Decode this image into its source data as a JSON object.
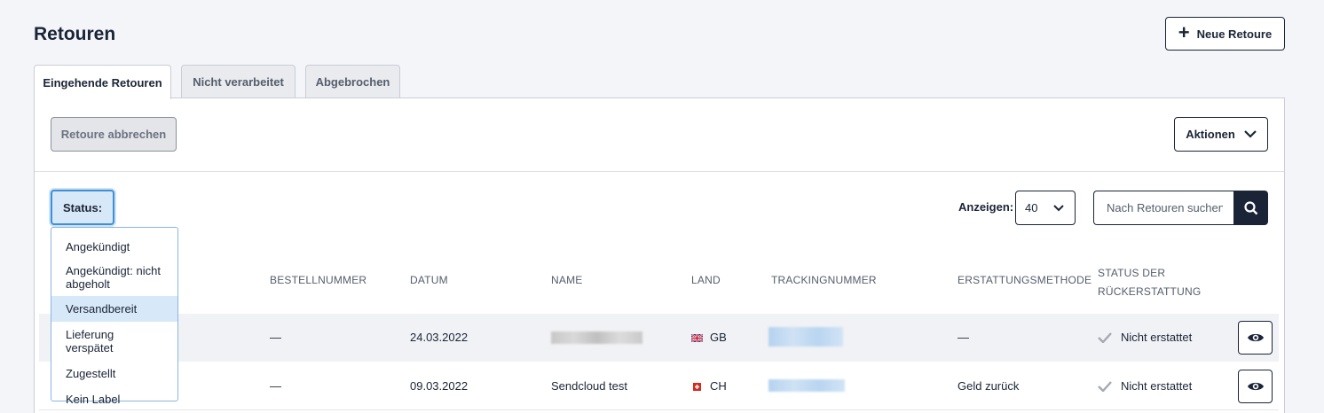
{
  "page": {
    "title": "Retouren",
    "new_return_label": "Neue Retoure"
  },
  "tabs": [
    {
      "label": "Eingehende Retouren",
      "active": true
    },
    {
      "label": "Nicht verarbeitet",
      "active": false
    },
    {
      "label": "Abgebrochen",
      "active": false
    }
  ],
  "toolbar": {
    "cancel_label": "Retoure abbrechen",
    "actions_label": "Aktionen"
  },
  "filters": {
    "status_label": "Status:",
    "show_label": "Anzeigen:",
    "per_page": "40",
    "search_placeholder": "Nach Retouren suchen"
  },
  "status_dropdown": {
    "options": [
      "Angekündigt",
      "Angekündigt: nicht abgeholt",
      "Versandbereit",
      "Lieferung verspätet",
      "Zugestellt",
      "Kein Label"
    ],
    "highlighted": "Versandbereit"
  },
  "table": {
    "columns": {
      "order": "BESTELLNUMMER",
      "date": "DATUM",
      "name": "NAME",
      "country": "LAND",
      "tracking": "TRACKINGNUMMER",
      "refund_method": "ERSTATTUNGSMETHODE",
      "refund_status_1": "STATUS DER",
      "refund_status_2": "RÜCKERSTATTUNG"
    },
    "rows": [
      {
        "order": "—",
        "date": "24.03.2022",
        "name": "",
        "country": "GB",
        "tracking": "",
        "refund_method": "—",
        "refund_status": "Nicht erstattet"
      },
      {
        "order": "—",
        "date": "09.03.2022",
        "name": "Sendcloud test",
        "country": "CH",
        "tracking": "",
        "refund_method": "Geld zurück",
        "refund_status": "Nicht erstattet"
      }
    ]
  },
  "colors": {
    "primary": "#1b2437",
    "accent_blue": "#3f8fd6",
    "highlight": "#d7e8f8"
  }
}
